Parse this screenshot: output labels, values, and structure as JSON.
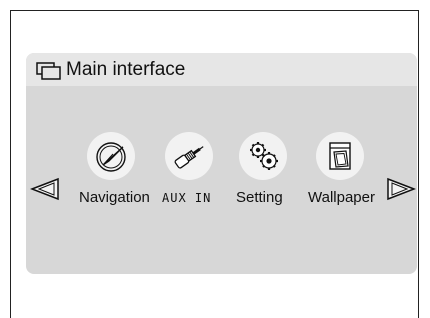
{
  "window": {
    "title": "Main interface",
    "title_icon": "windows-icon"
  },
  "menu": {
    "items": [
      {
        "label": "Navigation",
        "icon": "compass-icon"
      },
      {
        "label": "AUX IN",
        "icon": "aux-plug-icon"
      },
      {
        "label": "Setting",
        "icon": "gears-icon"
      },
      {
        "label": "Wallpaper",
        "icon": "wallpaper-icon"
      }
    ]
  },
  "nav": {
    "prev_icon": "left-arrow-icon",
    "next_icon": "right-arrow-icon"
  },
  "colors": {
    "panel": "#d7d7d7",
    "title_bar": "#e6e6e6",
    "icon_bg": "#f2f2f2",
    "text": "#111111"
  }
}
